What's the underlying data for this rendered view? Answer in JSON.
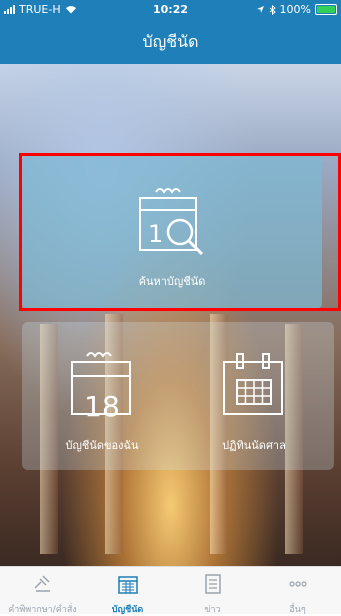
{
  "status_bar": {
    "carrier": "TRUE-H",
    "time": "10:22",
    "battery": "100%"
  },
  "header": {
    "title": "บัญชีนัด"
  },
  "cards": {
    "search": {
      "label": "ค้นหาบัญชีนัด",
      "icon": "search-calendar-icon"
    },
    "my_appointments": {
      "label": "บัญชีนัดของฉัน",
      "calendar_number": "18",
      "icon": "calendar-18-icon"
    },
    "court_calendar": {
      "label": "ปฏิทินนัดศาล",
      "icon": "calendar-grid-icon"
    }
  },
  "tabs": [
    {
      "label": "คำพิพากษา/คำสั่ง",
      "icon": "gavel-icon"
    },
    {
      "label": "บัญชีนัด",
      "icon": "calendar-tab-icon"
    },
    {
      "label": "ข่าว",
      "icon": "news-icon"
    },
    {
      "label": "อื่นๆ",
      "icon": "more-icon"
    }
  ],
  "colors": {
    "primary": "#1f7fb8",
    "highlight_border": "#ff0000"
  }
}
